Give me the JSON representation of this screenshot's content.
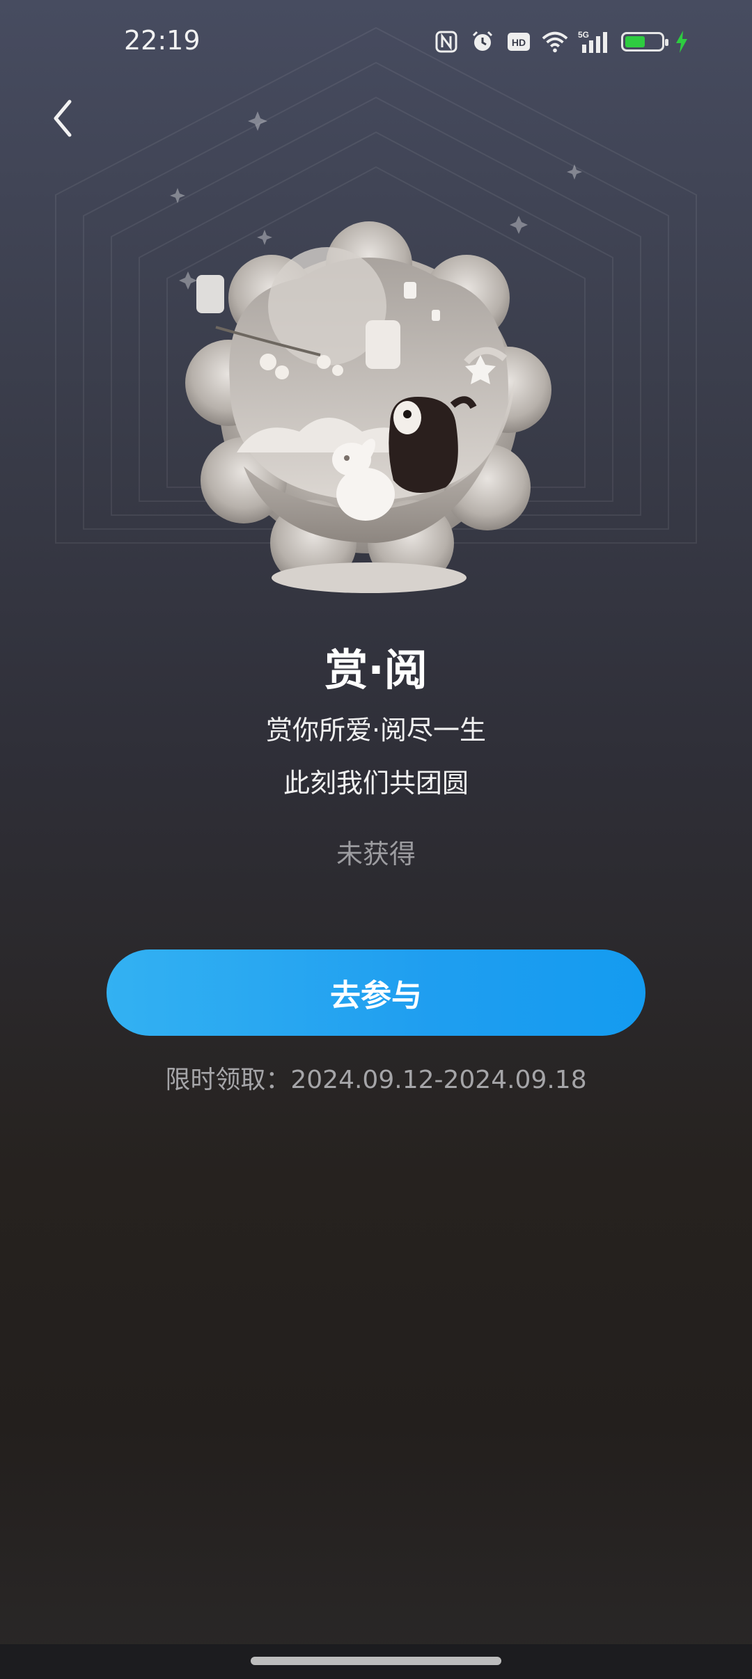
{
  "status_bar": {
    "time": "22:19",
    "icons": [
      "nfc-icon",
      "alarm-icon",
      "hd-icon",
      "wifi-icon",
      "5g-signal-icon",
      "battery-icon",
      "charging-icon"
    ],
    "network": "5G",
    "hd": "HD"
  },
  "header": {
    "back_icon": "chevron-left-icon"
  },
  "badge": {
    "title": "赏·阅",
    "line1": "赏你所爱·阅尽一生",
    "line2": "此刻我们共团圆",
    "status": "未获得"
  },
  "action": {
    "join_label": "去参与"
  },
  "period": {
    "text": "限时领取：2024.09.12-2024.09.18"
  },
  "colors": {
    "accent": "#1e9ef0",
    "battery_green": "#2ecc40"
  }
}
